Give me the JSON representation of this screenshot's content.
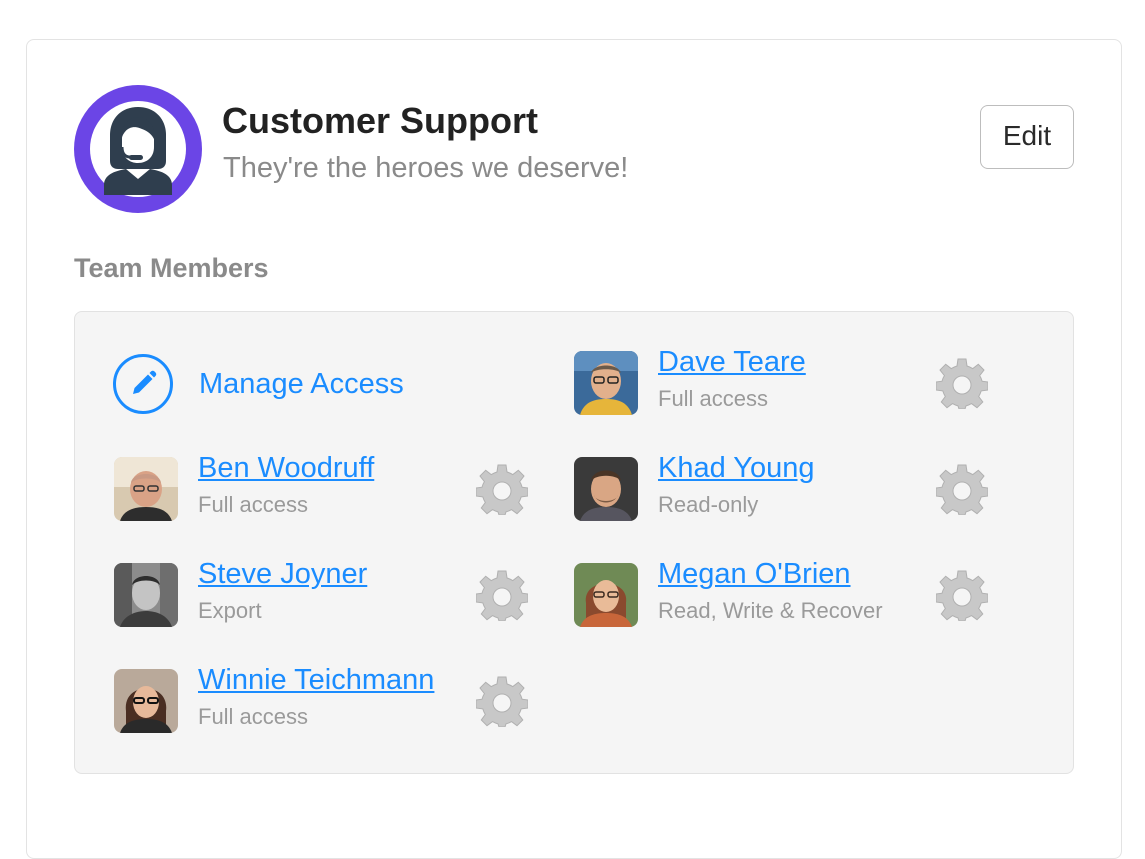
{
  "team": {
    "name": "Customer Support",
    "description": "They're the heroes we deserve!",
    "edit_label": "Edit",
    "avatar_icon": "support-agent-icon",
    "avatar_ring_color": "#6b45e6"
  },
  "members_section": {
    "title": "Team Members",
    "manage_access_label": "Manage Access",
    "manage_access_icon": "pencil-icon"
  },
  "members": [
    {
      "name": "Dave Teare",
      "role": "Full access"
    },
    {
      "name": "Ben Woodruff",
      "role": "Full access"
    },
    {
      "name": "Khad Young",
      "role": "Read-only"
    },
    {
      "name": "Steve Joyner",
      "role": "Export"
    },
    {
      "name": "Megan O'Brien",
      "role": "Read, Write & Recover"
    },
    {
      "name": "Winnie Teichmann",
      "role": "Full access"
    }
  ],
  "colors": {
    "link": "#1a8cff",
    "muted_text": "#9a9a9a",
    "gear": "#c8c8c8"
  }
}
